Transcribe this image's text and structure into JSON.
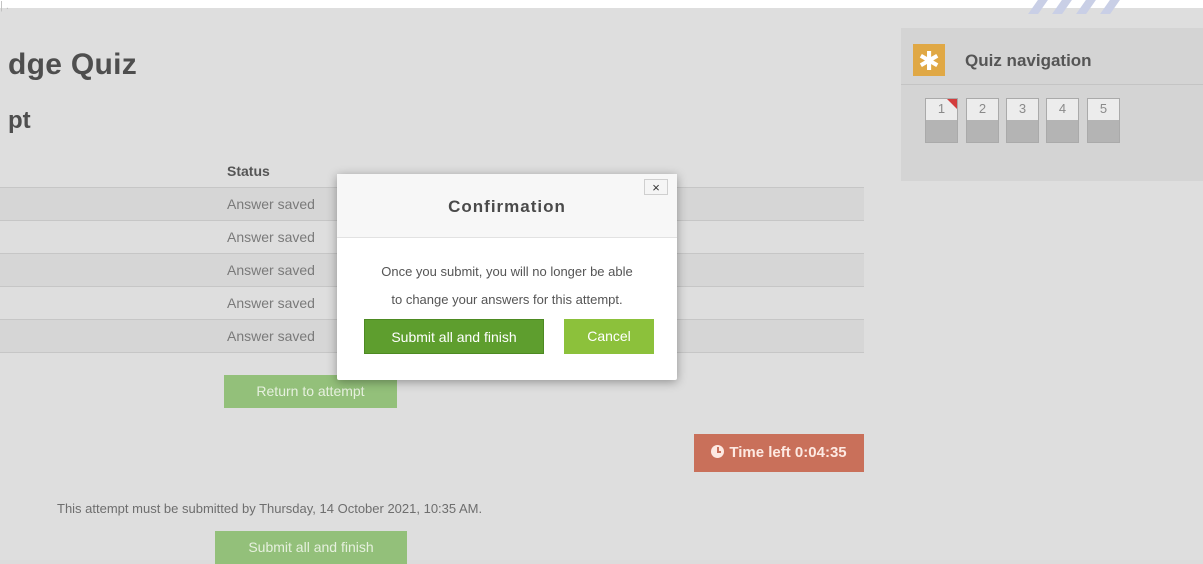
{
  "page": {
    "quiz_title": "dge Quiz",
    "attempt_heading": "pt",
    "breadcrumb_fragment": "| ."
  },
  "summary": {
    "status_header": "Status",
    "rows": [
      {
        "status": "Answer saved"
      },
      {
        "status": "Answer saved"
      },
      {
        "status": "Answer saved"
      },
      {
        "status": "Answer saved"
      },
      {
        "status": "Answer saved"
      }
    ],
    "return_button": "Return to attempt"
  },
  "timer": {
    "label": "Time left 0:04:35",
    "color": "#c9705a"
  },
  "deadline_text": "This attempt must be submitted by Thursday, 14 October 2021, 10:35 AM.",
  "submit_bottom_label": "Submit all and finish",
  "quiz_navigation": {
    "title": "Quiz navigation",
    "icon": "asterisk-icon",
    "questions": [
      "1",
      "2",
      "3",
      "4",
      "5"
    ],
    "flagged": [
      "1"
    ]
  },
  "modal": {
    "title": "Confirmation",
    "close_glyph": "×",
    "message_line1": "Once you submit, you will no longer be able",
    "message_line2": "to change your answers for this attempt.",
    "confirm_label": "Submit all and finish",
    "cancel_label": "Cancel",
    "confirm_color": "#5e9e2e",
    "cancel_color": "#8cc13b"
  }
}
